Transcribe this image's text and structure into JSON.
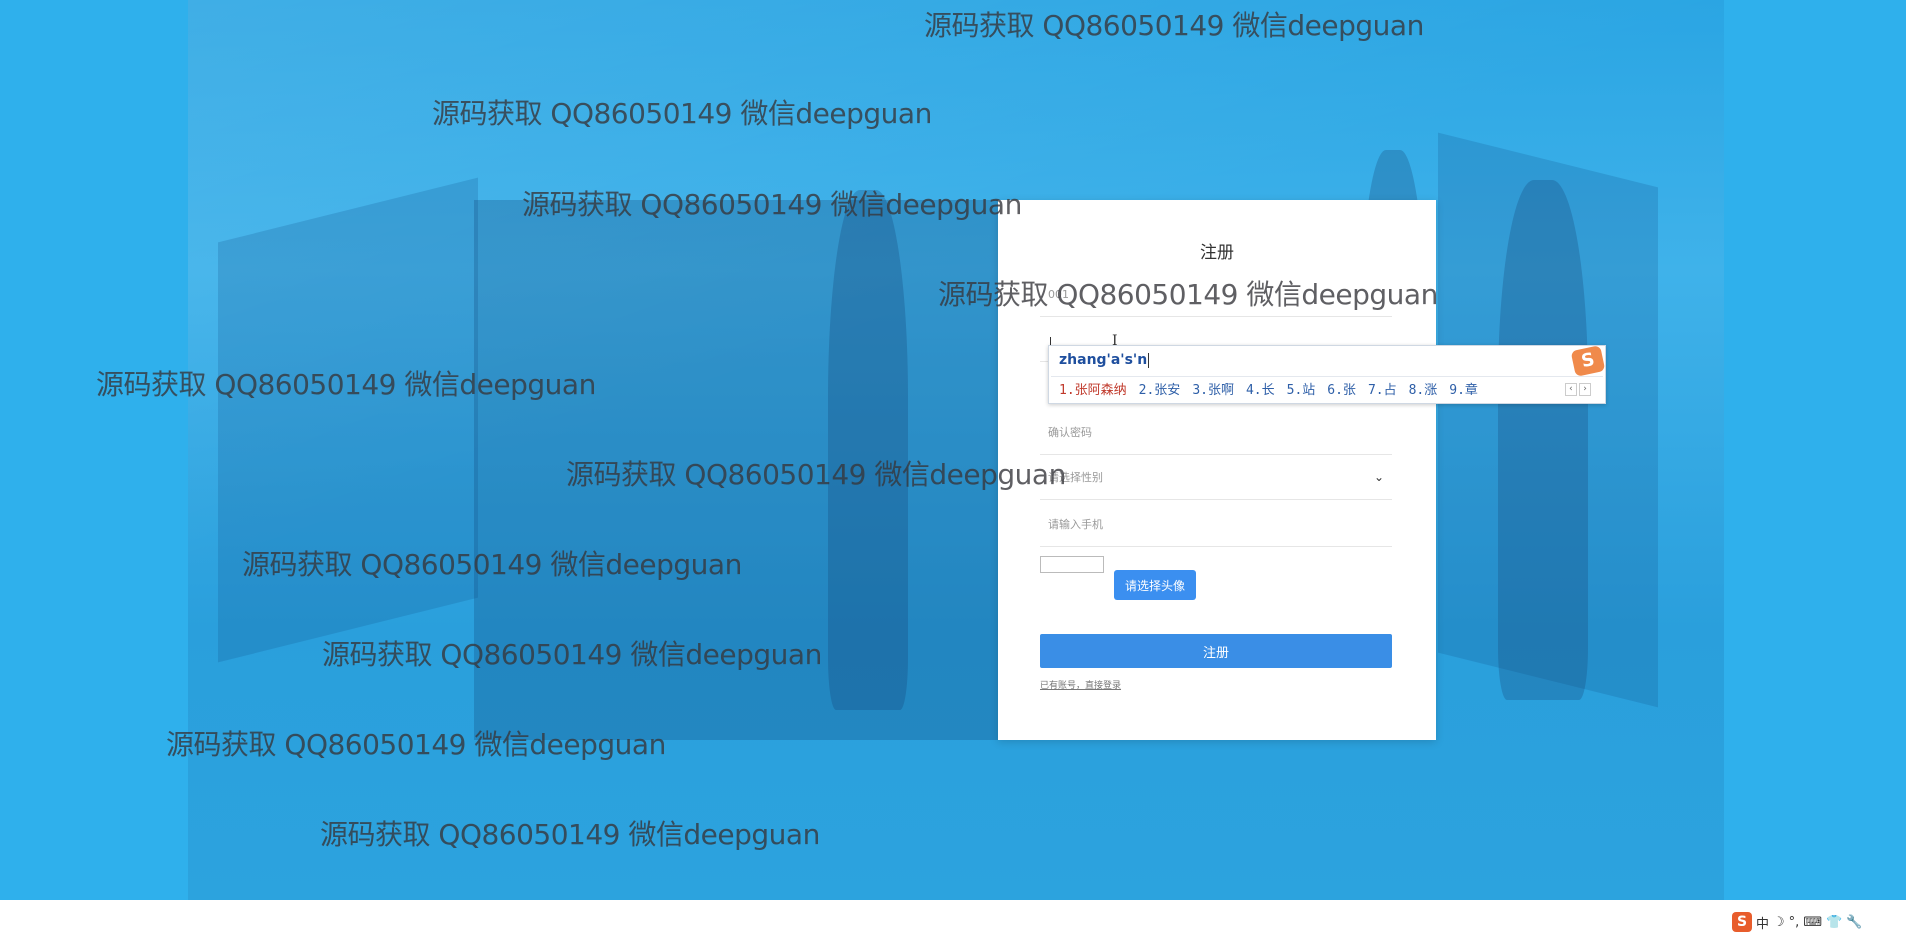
{
  "card": {
    "title": "注册",
    "username_value": "001",
    "confirm_password_placeholder": "确认密码",
    "gender_placeholder": "请选择性别",
    "phone_placeholder": "请输入手机",
    "avatar_button": "请选择头像",
    "submit_button": "注册",
    "login_link": "已有账号，直接登录"
  },
  "ime": {
    "composition": "zhang'a's'n",
    "candidates": [
      "1.张阿森纳",
      "2.张安",
      "3.张啊",
      "4.长",
      "5.站",
      "6.张",
      "7.占",
      "8.涨",
      "9.章"
    ],
    "logo": "S",
    "pager_prev": "‹",
    "pager_next": "›"
  },
  "watermark_text": "源码获取 QQ86050149 微信deepguan",
  "tray": {
    "logo": "S",
    "items": [
      "中",
      "☽",
      "°,",
      "⌨",
      "👕",
      "🔧"
    ]
  }
}
